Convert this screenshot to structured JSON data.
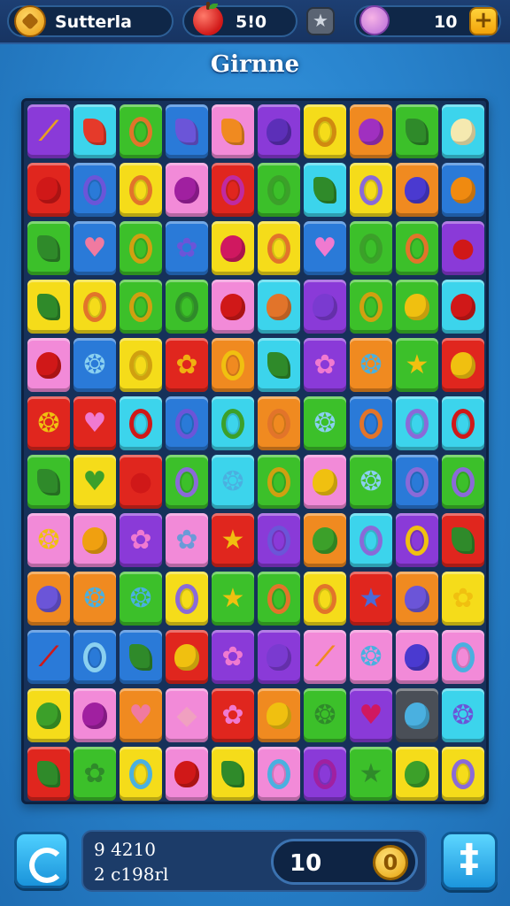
{
  "header": {
    "player_name": "Sutterla",
    "score": "5!0",
    "lives_count": "10",
    "icons": {
      "coin": "coin-icon",
      "fruit": "apple-icon",
      "badge": "star-badge-icon",
      "candy": "candy-icon",
      "add": "plus-icon"
    }
  },
  "title": "Girnne",
  "board": {
    "rows": 12,
    "cols": 10,
    "tiles": [
      [
        "purple:sword:#e8a020",
        "cyan:leaf:#e53a2a",
        "green:ring:#e2742a",
        "blue:leaf:#6b55d8",
        "pink:leaf:#f08a20",
        "purple:blob:#5c2fb8",
        "yellow:ring:#d08a10",
        "orange:blob:#a030c0",
        "green:leaf:#2f8a2a",
        "cyan:blob:#f5e9b0"
      ],
      [
        "red:blob:#d01818",
        "blue:ring:#6b55d8",
        "yellow:ring:#e2742a",
        "pink:blob:#a020a0",
        "red:ring:#c02aa0",
        "green:ring:#3ca02a",
        "cyan:leaf:#2f8a2a",
        "yellow:ring:#8a6ad8",
        "orange:blob:#4a3ad0",
        "blue:blob:#f08a10"
      ],
      [
        "green:leaf:#2f8a2a",
        "blue:heart:#f07aa0",
        "green:ring:#d0a010",
        "blue:flower:#6b55d8",
        "yellow:blob:#d01860",
        "yellow:ring:#e2742a",
        "blue:heart:#f07ad0",
        "green:ring:#3ca02a",
        "green:ring:#e2742a",
        "purple:berries:#d01818"
      ],
      [
        "yellow:leaf:#2f8a2a",
        "yellow:ring:#e2742a",
        "green:ring:#d0a010",
        "green:ring:#2f8a2a",
        "pink:blob:#d01818",
        "cyan:blob:#e2742a",
        "purple:blob:#7a3ad0",
        "green:ring:#d0a010",
        "green:blob:#f0c010",
        "cyan:blob:#d01818"
      ],
      [
        "pink:blob:#d01818",
        "blue:swirl:#8ad0f0",
        "yellow:ring:#d0a010",
        "red:flower:#f0b010",
        "orange:ring:#f0c010",
        "cyan:leaf:#2f8a2a",
        "purple:flower:#f07ad0",
        "orange:swirl:#4ab0e0",
        "green:star:#f0c010",
        "red:blob:#f0c010"
      ],
      [
        "red:swirl:#f0c010",
        "red:heart:#f07ad0",
        "cyan:ring:#d01818",
        "blue:ring:#6b55d8",
        "cyan:ring:#3ca02a",
        "orange:ring:#e2742a",
        "green:swirl:#8ad0f0",
        "blue:ring:#e2742a",
        "cyan:ring:#8a6ad8",
        "cyan:ring:#d01818"
      ],
      [
        "green:leaf:#2f8a2a",
        "yellow:heart:#3ca02a",
        "red:berries:#d01818",
        "green:ring:#8a6ad8",
        "cyan:swirl:#4ab0e0",
        "green:ring:#d0a010",
        "pink:blob:#f0c010",
        "green:swirl:#8ad0f0",
        "blue:ring:#8a6ad8",
        "green:ring:#8a6ad8"
      ],
      [
        "pink:swirl:#f0c010",
        "pink:blob:#f0a010",
        "purple:flower:#f07ad0",
        "pink:flower:#6b9ad8",
        "red:star:#f0c010",
        "purple:ring:#6b55d8",
        "orange:blob:#3ca02a",
        "cyan:ring:#8a6ad8",
        "purple:ring:#f0c010",
        "red:leaf:#2f8a2a"
      ],
      [
        "orange:blob:#6b55d8",
        "orange:swirl:#4ab0e0",
        "green:swirl:#4ab0e0",
        "yellow:ring:#8a6ad8",
        "green:star:#f0c010",
        "green:ring:#e2742a",
        "yellow:ring:#e2742a",
        "red:star:#4a6ad8",
        "orange:blob:#6b55d8",
        "yellow:flower:#f0c010"
      ],
      [
        "blue:sword:#d01818",
        "blue:ring:#8ad0f0",
        "blue:leaf:#2f8a2a",
        "red:blob:#f0c010",
        "purple:flower:#f07ad0",
        "purple:blob:#7a3ad0",
        "pink:sword:#f08a20",
        "pink:swirl:#4ab0e0",
        "pink:blob:#4a3ad0",
        "pink:ring:#4ab0e0"
      ],
      [
        "yellow:blob:#3ca02a",
        "pink:blob:#a020a0",
        "orange:heart:#f07aa0",
        "pink:gem:#f0a0c0",
        "red:flower:#f07ad0",
        "orange:blob:#f0c010",
        "green:swirl:#2f8a2a",
        "purple:heart:#d01860",
        "gray:blob:#4ab0e0",
        "cyan:swirl:#6b55d8"
      ],
      [
        "red:leaf:#2f8a2a",
        "green:flower:#2f8a2a",
        "yellow:ring:#4ab0e0",
        "pink:blob:#d01818",
        "yellow:leaf:#2f8a2a",
        "pink:ring:#4ab0e0",
        "purple:ring:#a020a0",
        "green:star:#2f8a2a",
        "yellow:blob:#3ca02a",
        "yellow:ring:#8a6ad8"
      ]
    ]
  },
  "tile_colors": {
    "purple": "#8a3ad8",
    "cyan": "#3cd4ec",
    "green": "#3cc02a",
    "blue": "#2a7ad8",
    "pink": "#f28ad8",
    "yellow": "#f5dc1a",
    "orange": "#f08a20",
    "red": "#e0261e",
    "gray": "#4a4f57"
  },
  "footer": {
    "stat_line_1": "9 4210",
    "stat_line_2": "2 c198rl",
    "moves_count": "10",
    "coin_symbol": "0",
    "add_symbol": "‡"
  }
}
